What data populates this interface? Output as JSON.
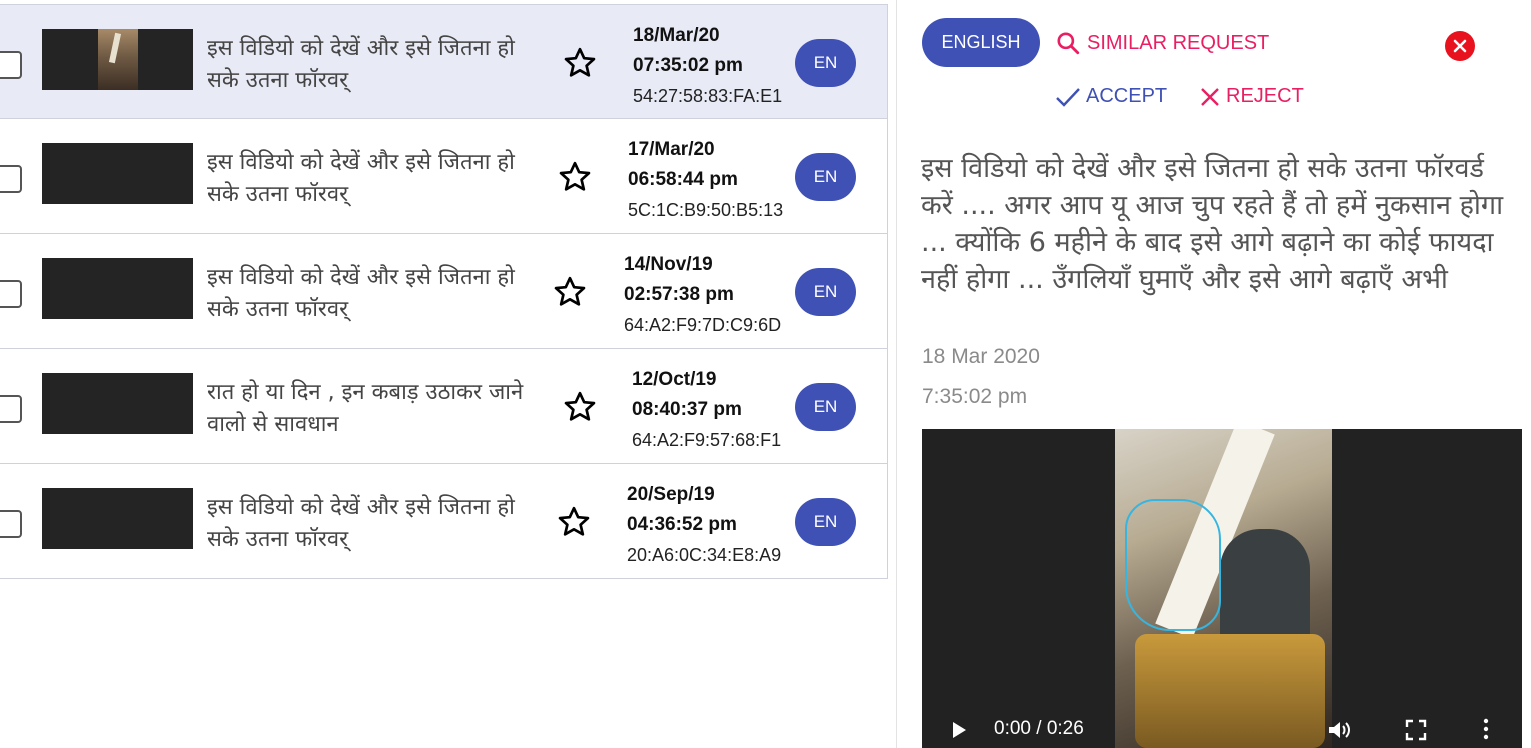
{
  "messages": [
    {
      "text": "इस विडियो को देखें और इसे जितना हो सके उतना फॉरवर्",
      "date": "18/Mar/20",
      "time": "07:35:02 pm",
      "mac": "54:27:58:83:FA:E1",
      "lang": "EN"
    },
    {
      "text": "इस विडियो को देखें और इसे जितना हो सके उतना फॉरवर्",
      "date": "17/Mar/20",
      "time": "06:58:44 pm",
      "mac": "5C:1C:B9:50:B5:13",
      "lang": "EN"
    },
    {
      "text": "इस विडियो को देखें और इसे जितना हो सके उतना फॉरवर्",
      "date": "14/Nov/19",
      "time": "02:57:38 pm",
      "mac": "64:A2:F9:7D:C9:6D",
      "lang": "EN"
    },
    {
      "text": "रात हो या दिन , इन कबाड़ उठाकर जाने वालो से सावधान",
      "date": "12/Oct/19",
      "time": "08:40:37 pm",
      "mac": "64:A2:F9:57:68:F1",
      "lang": "EN"
    },
    {
      "text": "इस विडियो को देखें और इसे जितना हो सके उतना फॉरवर्",
      "date": "20/Sep/19",
      "time": "04:36:52 pm",
      "mac": "20:A6:0C:34:E8:A9",
      "lang": "EN"
    }
  ],
  "detail": {
    "language_button": "ENGLISH",
    "similar_label": "SIMILAR REQUEST",
    "accept_label": "ACCEPT",
    "reject_label": "REJECT",
    "text": "इस विडियो को देखें और इसे जितना हो सके उतना फॉरवर्ड करें .... अगर आप यू आज चुप रहते हैं तो हमें नुकसान होगा ... क्योंकि 6 महीने के बाद इसे आगे बढ़ाने का कोई फायदा नहीं होगा ... उँगलियाँ घुमाएँ और इसे आगे बढ़ाएँ अभी",
    "date": "18 Mar 2020",
    "time": "7:35:02 pm",
    "video_time": "0:00 / 0:26"
  },
  "colors": {
    "primary": "#3f51b5",
    "accent": "#e91e63",
    "danger": "#e8121e",
    "selected_row": "#e8eaf6"
  }
}
